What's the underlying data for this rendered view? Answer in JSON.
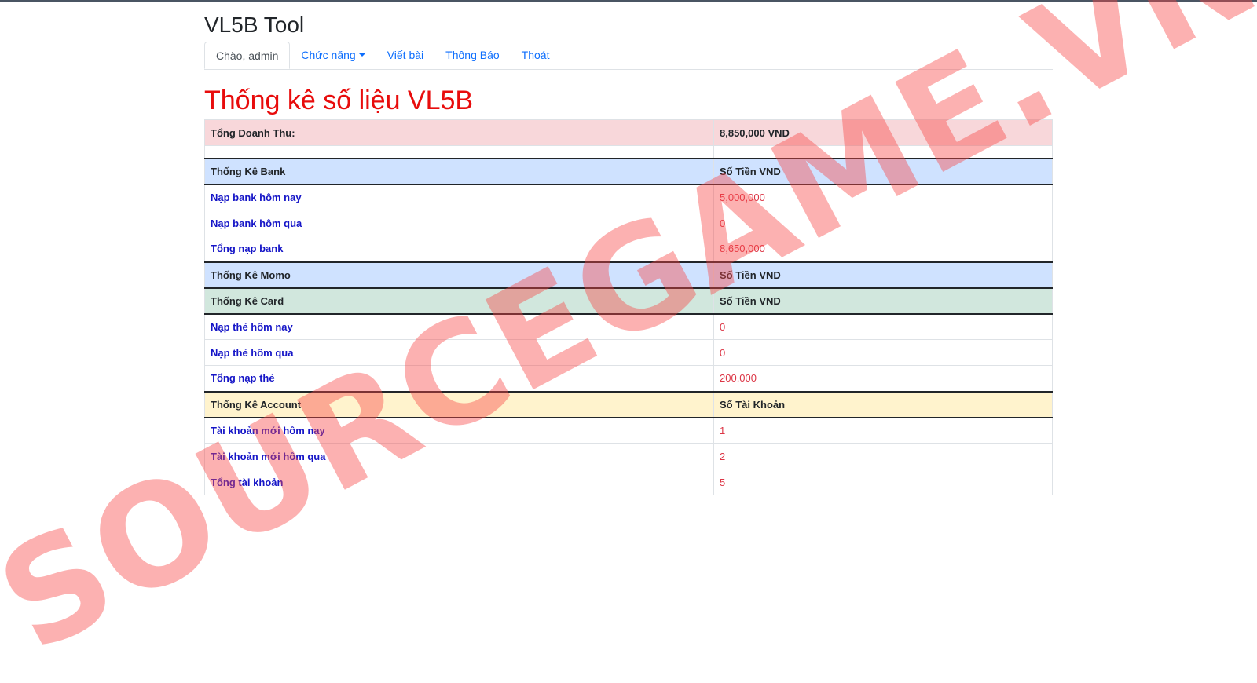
{
  "app": {
    "title": "VL5B Tool"
  },
  "nav": {
    "greeting": "Chào, admin",
    "functions": "Chức năng",
    "write_post": "Viết bài",
    "notifications": "Thông Báo",
    "logout": "Thoát"
  },
  "page": {
    "title": "Thống kê số liệu VL5B"
  },
  "revenue": {
    "label": "Tổng Doanh Thu:",
    "value": "8,850,000 VND"
  },
  "bank": {
    "header": {
      "label": "Thống Kê Bank",
      "value_label": "Số Tiền VND"
    },
    "rows": [
      {
        "label": "Nạp bank hôm nay",
        "value": "5,000,000"
      },
      {
        "label": "Nạp bank hôm qua",
        "value": "0"
      },
      {
        "label": "Tổng nạp bank",
        "value": "8,650,000"
      }
    ]
  },
  "momo": {
    "header": {
      "label": "Thống Kê Momo",
      "value_label": "Số Tiền VND"
    }
  },
  "card": {
    "header": {
      "label": "Thống Kê Card",
      "value_label": "Số Tiền VND"
    },
    "rows": [
      {
        "label": "Nạp thẻ hôm nay",
        "value": "0"
      },
      {
        "label": "Nạp thẻ hôm qua",
        "value": "0"
      },
      {
        "label": "Tổng nạp thẻ",
        "value": "200,000"
      }
    ]
  },
  "account": {
    "header": {
      "label": "Thống Kê Account",
      "value_label": "Số Tài Khoản"
    },
    "rows": [
      {
        "label": "Tài khoản mới hôm nay",
        "value": "1"
      },
      {
        "label": "Tài khoản mới hôm qua",
        "value": "2"
      },
      {
        "label": "Tổng tài khoản",
        "value": "5"
      }
    ]
  },
  "watermark": {
    "text": "SOURCEGAME.VN"
  }
}
